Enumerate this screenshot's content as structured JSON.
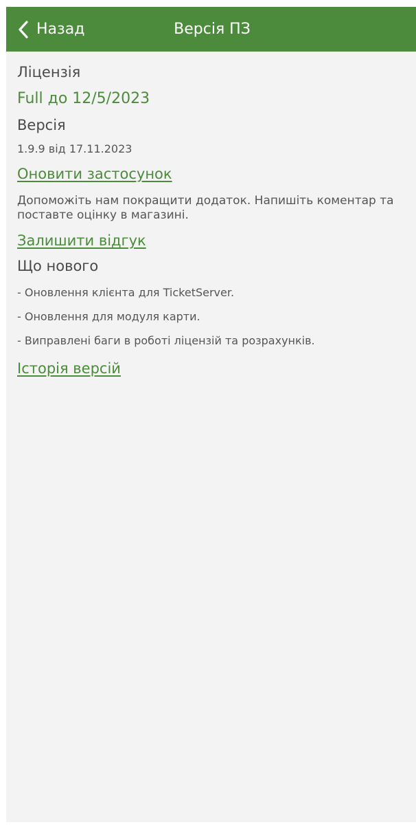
{
  "header": {
    "back_label": "Назад",
    "title": "Версія ПЗ",
    "bar_color": "#4b8b3b"
  },
  "license": {
    "label": "Ліцензія",
    "value": "Full до 12/5/2023"
  },
  "version": {
    "label": "Версія",
    "value": "1.9.9 від 17.11.2023"
  },
  "update_link": "Оновити застосунок",
  "feedback": {
    "prompt": "Допоможіть нам покращити додаток. Напишіть коментар та поставте оцінку в магазині.",
    "link": "Залишити відгук"
  },
  "whats_new": {
    "title": "Що нового",
    "items": [
      "- Оновлення клієнта для TicketServer.",
      "- Оновлення для модуля карти.",
      "- Виправлені баги в роботі ліцензій та розрахунків."
    ]
  },
  "history_link": "Історія версій",
  "colors": {
    "accent": "#4b8b3b",
    "background": "#f3f3f3",
    "text": "#4a4a4a"
  }
}
